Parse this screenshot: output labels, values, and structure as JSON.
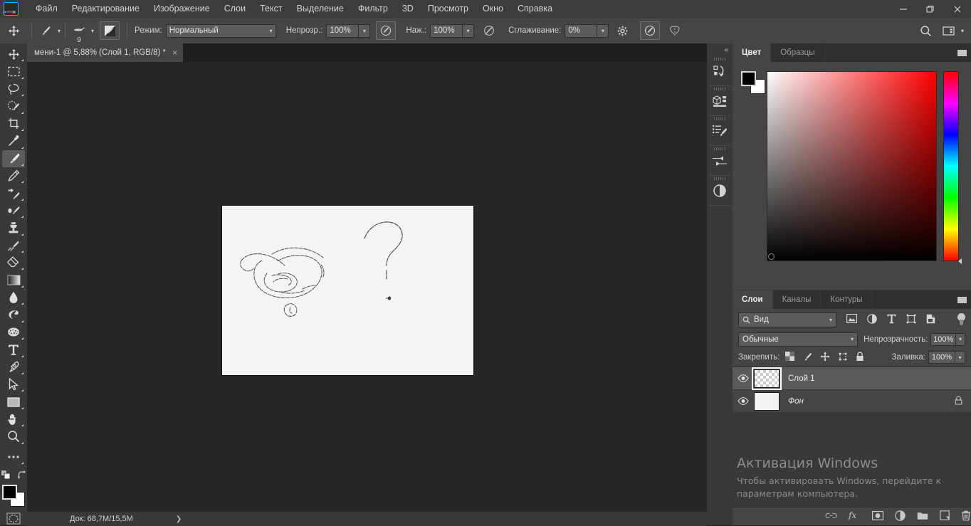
{
  "app": {
    "name": "Adobe Photoshop",
    "logo_icon": "photoshop-logo-icon"
  },
  "menubar": {
    "items": [
      {
        "label": "Файл",
        "name": "menu-file"
      },
      {
        "label": "Редактирование",
        "name": "menu-edit"
      },
      {
        "label": "Изображение",
        "name": "menu-image"
      },
      {
        "label": "Слои",
        "name": "menu-layers"
      },
      {
        "label": "Текст",
        "name": "menu-text"
      },
      {
        "label": "Выделение",
        "name": "menu-select"
      },
      {
        "label": "Фильтр",
        "name": "menu-filter"
      },
      {
        "label": "3D",
        "name": "menu-3d"
      },
      {
        "label": "Просмотр",
        "name": "menu-view"
      },
      {
        "label": "Окно",
        "name": "menu-window"
      },
      {
        "label": "Справка",
        "name": "menu-help"
      }
    ],
    "window_controls": {
      "minimize": "—",
      "restore": "❐",
      "close": "✕"
    }
  },
  "options_bar": {
    "active_tool_icon": "move-tool-icon",
    "brush_preset_icon": "brush-preset-icon",
    "brush_size": "9",
    "airbrush_icon": "airbrush-toggle-icon",
    "mode_label": "Режим:",
    "mode_value": "Нормальный",
    "opacity_label": "Непрозр.:",
    "opacity_value": "100%",
    "opacity_pressure_icon": "pressure-opacity-icon",
    "flow_label": "Наж.:",
    "flow_value": "100%",
    "flow_pressure_icon": "pressure-flow-icon",
    "smoothing_label": "Сглаживание:",
    "smoothing_value": "0%",
    "smoothing_gear_icon": "gear-icon",
    "tablet_pressure_icon": "tablet-pressure-icon",
    "symmetry_icon": "symmetry-butterfly-icon",
    "search_icon": "search-icon",
    "workspace_icon": "workspace-switcher-icon"
  },
  "toolbar": {
    "tools": [
      {
        "name": "move-tool",
        "icon": "move-icon",
        "active": false
      },
      {
        "name": "rectangular-marquee-tool",
        "icon": "marquee-icon",
        "active": false
      },
      {
        "name": "lasso-tool",
        "icon": "lasso-icon",
        "active": false
      },
      {
        "name": "quick-selection-tool",
        "icon": "quick-selection-icon",
        "active": false
      },
      {
        "name": "crop-tool",
        "icon": "crop-icon",
        "active": false
      },
      {
        "name": "eyedropper-tool",
        "icon": "eyedropper-icon",
        "active": false
      },
      {
        "name": "brush-tool",
        "icon": "brush-icon",
        "active": true
      },
      {
        "name": "pencil-tool",
        "icon": "pencil-icon",
        "active": false
      },
      {
        "name": "healing-brush-tool",
        "icon": "healing-brush-icon",
        "active": false
      },
      {
        "name": "mixer-brush-tool",
        "icon": "mixer-brush-icon",
        "active": false
      },
      {
        "name": "clone-stamp-tool",
        "icon": "clone-stamp-icon",
        "active": false
      },
      {
        "name": "history-brush-tool",
        "icon": "history-brush-icon",
        "active": false
      },
      {
        "name": "eraser-tool",
        "icon": "eraser-icon",
        "active": false
      },
      {
        "name": "gradient-tool",
        "icon": "gradient-icon",
        "active": false
      },
      {
        "name": "blur-tool",
        "icon": "blur-droplet-icon",
        "active": false
      },
      {
        "name": "dodge-tool",
        "icon": "dodge-icon",
        "active": false
      },
      {
        "name": "sponge-tool",
        "icon": "sponge-icon",
        "active": false
      },
      {
        "name": "type-tool",
        "icon": "type-icon",
        "active": false
      },
      {
        "name": "pen-tool",
        "icon": "pen-icon",
        "active": false
      },
      {
        "name": "path-selection-tool",
        "icon": "path-arrow-icon",
        "active": false
      },
      {
        "name": "rectangle-tool",
        "icon": "rectangle-icon",
        "active": false
      },
      {
        "name": "hand-tool",
        "icon": "hand-icon",
        "active": false
      },
      {
        "name": "zoom-tool",
        "icon": "magnifier-icon",
        "active": false
      },
      {
        "name": "edit-toolbar-tool",
        "icon": "ellipsis-icon",
        "active": false
      }
    ],
    "swap_colors_icon": "swap-colors-icon",
    "default_colors_icon": "default-colors-icon",
    "foreground_color": "#000000",
    "background_color": "#ffffff",
    "quick_mask_icon": "quick-mask-icon"
  },
  "document": {
    "tab_title": "мени-1 @ 5,88% (Слой 1, RGB/8) *",
    "close_icon": "close-icon",
    "zoom": "5,88%",
    "canvas_background": "#f4f4f4"
  },
  "statusbar": {
    "doc_label": "Док: 68,7M/15,5M",
    "expand_icon": "chevron-right-icon"
  },
  "icon_dock": {
    "collapse_icon": "collapse-panels-icon",
    "items": [
      {
        "name": "dock-history-panel",
        "icon": "history-icon"
      },
      {
        "name": "dock-libraries-panel",
        "icon": "libraries-3d-icon"
      },
      {
        "name": "dock-brush-settings-panel",
        "icon": "brush-settings-icon"
      },
      {
        "name": "dock-brushes-panel",
        "icon": "brush-presets-icon"
      },
      {
        "name": "dock-adjustments-panel",
        "icon": "adjustments-icon"
      }
    ]
  },
  "color_panel": {
    "tabs": [
      {
        "label": "Цвет",
        "name": "tab-color",
        "active": true
      },
      {
        "label": "Образцы",
        "name": "tab-swatches",
        "active": false
      }
    ],
    "menu_icon": "panel-menu-icon",
    "foreground_color": "#000000",
    "background_color": "#ffffff",
    "spectrum": "hsb-field",
    "hue_strip": "hue-slider"
  },
  "layers_panel": {
    "tabs": [
      {
        "label": "Слои",
        "name": "tab-layers",
        "active": true
      },
      {
        "label": "Каналы",
        "name": "tab-channels",
        "active": false
      },
      {
        "label": "Контуры",
        "name": "tab-paths",
        "active": false
      }
    ],
    "menu_icon": "panel-menu-icon",
    "filter": {
      "search_icon": "search-icon",
      "value": "Вид",
      "caret_icon": "chevron-down-icon",
      "type_icons": [
        {
          "name": "filter-pixel-icon",
          "icon": "image-icon"
        },
        {
          "name": "filter-adjustment-icon",
          "icon": "adjustment-circle-icon"
        },
        {
          "name": "filter-type-icon",
          "icon": "type-t-icon"
        },
        {
          "name": "filter-shape-icon",
          "icon": "shape-icon"
        },
        {
          "name": "filter-smart-object-icon",
          "icon": "smart-object-icon"
        }
      ],
      "toggle_icon": "filter-power-toggle"
    },
    "blend_mode_label": "Обычные",
    "opacity_label": "Непрозрачность:",
    "opacity_value": "100%",
    "lock_label": "Закрепить:",
    "lock_icons": [
      {
        "name": "lock-transparent-pixels-icon",
        "icon": "checkerboard-icon"
      },
      {
        "name": "lock-image-pixels-icon",
        "icon": "brush-icon"
      },
      {
        "name": "lock-position-icon",
        "icon": "move-arrows-icon"
      },
      {
        "name": "lock-artboard-nesting-icon",
        "icon": "artboard-icon"
      },
      {
        "name": "lock-all-icon",
        "icon": "lock-icon"
      }
    ],
    "fill_label": "Заливка:",
    "fill_value": "100%",
    "layers": [
      {
        "name": "Слой 1",
        "visible": true,
        "selected": true,
        "locked": false,
        "thumb": "transparent",
        "italic": false
      },
      {
        "name": "Фон",
        "visible": true,
        "selected": false,
        "locked": true,
        "thumb": "white",
        "italic": true
      }
    ],
    "footer_icons": [
      {
        "name": "link-layers-button",
        "icon": "link-icon"
      },
      {
        "name": "layer-style-button",
        "icon": "fx-icon"
      },
      {
        "name": "add-layer-mask-button",
        "icon": "mask-icon"
      },
      {
        "name": "new-fill-adjustment-button",
        "icon": "adjustment-circle-icon"
      },
      {
        "name": "new-group-button",
        "icon": "folder-icon"
      },
      {
        "name": "new-layer-button",
        "icon": "new-layer-icon"
      },
      {
        "name": "delete-layer-button",
        "icon": "trash-icon"
      }
    ]
  },
  "watermark": {
    "title": "Активация Windows",
    "line1": "Чтобы активировать Windows, перейдите к",
    "line2": "параметрам компьютера."
  },
  "colors": {
    "chrome": "#393939",
    "panel": "#454545",
    "menubar": "#3c3c3c",
    "canvas_bg": "#262626",
    "accent": "#31a8ff",
    "selected_row": "#5b5b5b"
  }
}
